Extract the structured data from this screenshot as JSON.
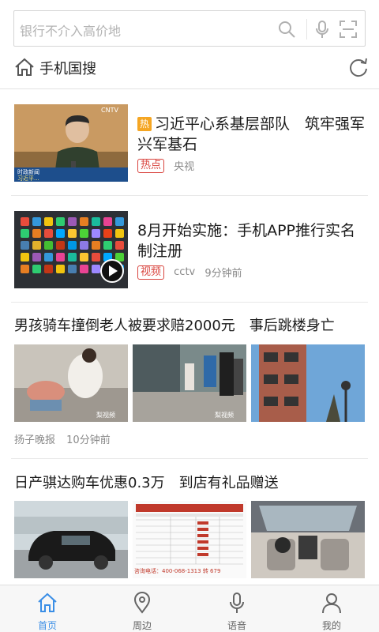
{
  "search": {
    "placeholder": "银行不介入高价地",
    "icons": [
      "search-icon",
      "microphone-icon",
      "qr-scan-icon"
    ]
  },
  "header": {
    "title": "手机国搜",
    "icons": [
      "home-icon",
      "refresh-icon"
    ]
  },
  "news": [
    {
      "title": "习近平心系基层部队　筑牢强军兴军基石",
      "hot_badge": "热",
      "tag": "热点",
      "source": "央视",
      "time": "",
      "thumb_caption_1": "时政新闻",
      "thumb_caption_2": "习近平...",
      "thumb_logo": "CNTV"
    },
    {
      "title": "8月开始实施：手机APP推行实名制注册",
      "tag": "视频",
      "source": "cctv",
      "time": "9分钟前"
    }
  ],
  "triple_news": [
    {
      "title": "男孩骑车撞倒老人被要求赔2000元　事后跳楼身亡",
      "source": "扬子晚报",
      "time": "10分钟前"
    },
    {
      "title": "日产骐达购车优惠0.3万　到店有礼品赠送",
      "source": "",
      "time": "",
      "ad_phone": "咨询电话：400-068-1313 转 679"
    }
  ],
  "colors": {
    "accent": "#3a8ee6",
    "tag_red": "#d9453f",
    "hot_orange": "#f5a623"
  },
  "bottom_nav": [
    {
      "label": "首页",
      "icon": "home-icon",
      "active": true
    },
    {
      "label": "周边",
      "icon": "location-pin-icon",
      "active": false
    },
    {
      "label": "语音",
      "icon": "microphone-icon",
      "active": false
    },
    {
      "label": "我的",
      "icon": "user-icon",
      "active": false
    }
  ]
}
